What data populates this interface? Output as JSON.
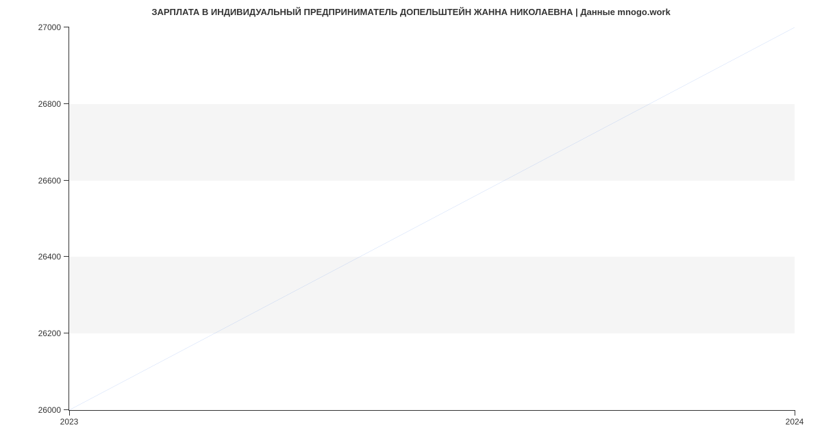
{
  "title": "ЗАРПЛАТА В ИНДИВИДУАЛЬНЫЙ ПРЕДПРИНИМАТЕЛЬ ДОПЕЛЬШТЕЙН ЖАННА НИКОЛАЕВНА | Данные mnogo.work",
  "chart_data": {
    "type": "line",
    "x": [
      2023,
      2024
    ],
    "y": [
      26000,
      27000
    ],
    "title": "ЗАРПЛАТА В ИНДИВИДУАЛЬНЫЙ ПРЕДПРИНИМАТЕЛЬ ДОПЕЛЬШТЕЙН ЖАННА НИКОЛАЕВНА | Данные mnogo.work",
    "xlabel": "",
    "ylabel": "",
    "xlim": [
      2023,
      2024
    ],
    "ylim": [
      26000,
      27000
    ],
    "x_ticks": [
      2023,
      2024
    ],
    "y_ticks": [
      26000,
      26200,
      26400,
      26600,
      26800,
      27000
    ],
    "x_tick_labels": [
      "2023",
      "2024"
    ],
    "y_tick_labels": [
      "26000",
      "26200",
      "26400",
      "26600",
      "26800",
      "27000"
    ],
    "line_color": "#6495ed"
  }
}
